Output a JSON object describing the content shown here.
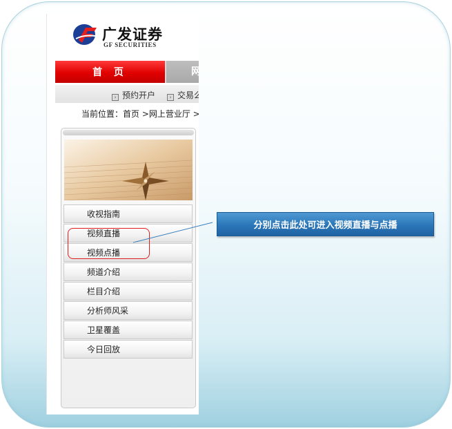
{
  "header": {
    "logo_cn": "广发证券",
    "logo_en": "GF SECURITIES"
  },
  "nav": {
    "home": "首 页",
    "tab2": "网"
  },
  "subnav": {
    "items": [
      "预约开户",
      "交易么"
    ]
  },
  "breadcrumb": "当前位置：首页 >网上营业厅 >",
  "menu": {
    "items": [
      "收视指南",
      "视频直播",
      "视频点播",
      "频道介绍",
      "栏目介绍",
      "分析师风采",
      "卫星覆盖",
      "今日回放"
    ]
  },
  "callout": "分别点击此处可进入视频直播与点播",
  "colors": {
    "nav_red": "#e00000",
    "callout_blue": "#2b76b8",
    "highlight_red": "#e21c1c"
  }
}
